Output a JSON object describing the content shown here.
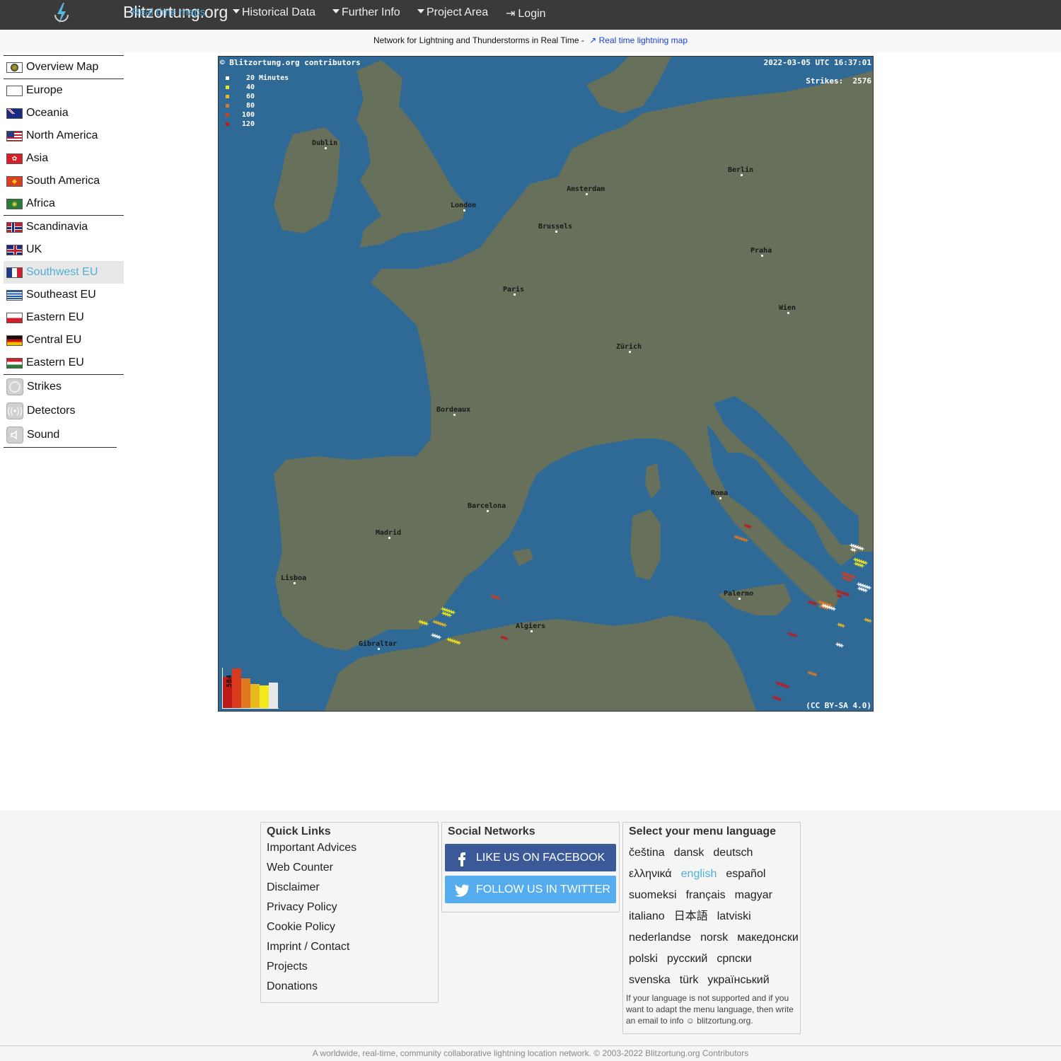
{
  "header": {
    "brand": "Blitzortung.org",
    "brand_overlay": "Real time maps",
    "nav": [
      {
        "label": "Historical Data"
      },
      {
        "label": "Further Info"
      },
      {
        "label": "Project Area"
      },
      {
        "label": "Login"
      }
    ]
  },
  "subbar": {
    "text": "Network for Lightning and Thunderstorms in Real Time -",
    "link": "Real time lightning map"
  },
  "sidebar": {
    "groups": [
      [
        {
          "label": "Overview Map",
          "icon": "globe-icon"
        }
      ],
      [
        {
          "label": "Europe",
          "icon": "flag-europe-icon"
        },
        {
          "label": "Oceania",
          "icon": "flag-australia-icon"
        },
        {
          "label": "North America",
          "icon": "flag-usa-icon"
        },
        {
          "label": "Asia",
          "icon": "flag-hongkong-icon"
        },
        {
          "label": "South America",
          "icon": "flag-south-america-icon"
        },
        {
          "label": "Africa",
          "icon": "flag-africa-icon"
        }
      ],
      [
        {
          "label": "Scandinavia",
          "icon": "flag-norway-icon"
        },
        {
          "label": "UK",
          "icon": "flag-uk-icon"
        },
        {
          "label": "Southwest EU",
          "icon": "flag-france-icon",
          "active": true
        },
        {
          "label": "Southeast EU",
          "icon": "flag-greece-icon"
        },
        {
          "label": "Eastern EU",
          "icon": "flag-poland-icon"
        },
        {
          "label": "Central EU",
          "icon": "flag-germany-icon"
        },
        {
          "label": "Eastern EU",
          "icon": "flag-hungary-icon"
        }
      ],
      [
        {
          "label": "Strikes",
          "icon": "strikes-icon"
        },
        {
          "label": "Detectors",
          "icon": "detectors-icon"
        },
        {
          "label": "Sound",
          "icon": "sound-icon"
        }
      ]
    ]
  },
  "map": {
    "attribution": "© Blitzortung.org contributors",
    "timestamp": "2022-03-05 UTC 16:37:01",
    "strikes_label": "Strikes:",
    "strikes_count": "2576",
    "license": "(CC BY-SA 4.0)",
    "legend": [
      {
        "value": "20",
        "unit": "Minutes",
        "color": "#ffffff"
      },
      {
        "value": "40",
        "unit": "",
        "color": "#f2e81e"
      },
      {
        "value": "60",
        "unit": "",
        "color": "#e8b91e"
      },
      {
        "value": "80",
        "unit": "",
        "color": "#e07820"
      },
      {
        "value": "100",
        "unit": "",
        "color": "#d83a1e"
      },
      {
        "value": "120",
        "unit": "",
        "color": "#c01818"
      }
    ],
    "histogram_label": "584",
    "cities": [
      "Dublin",
      "London",
      "Amsterdam",
      "Berlin",
      "Brussels",
      "Praha",
      "Paris",
      "Wien",
      "Zürich",
      "Bordeaux",
      "Roma",
      "Barcelona",
      "Madrid",
      "Lisboa",
      "Palermo",
      "Algiers",
      "Gibraltar"
    ],
    "colors": {
      "sea": "#2f6a96",
      "land": "#66705a",
      "border": "#e8e8e8"
    }
  },
  "footer": {
    "quick_links": {
      "title": "Quick Links",
      "items": [
        "Important Advices",
        "Web Counter",
        "Disclaimer",
        "Privacy Policy",
        "Cookie Policy",
        "Imprint / Contact",
        "Projects",
        "Donations"
      ]
    },
    "social": {
      "title": "Social Networks",
      "facebook": "LIKE US ON FACEBOOK",
      "twitter": "FOLLOW US IN TWITTER"
    },
    "language": {
      "title": "Select your menu language",
      "rows": [
        [
          "čeština",
          "dansk",
          "deutsch"
        ],
        [
          "ελληνικά",
          "english",
          "español"
        ],
        [
          "suomeksi",
          "français",
          "magyar"
        ],
        [
          "italiano",
          "日本語",
          "latviski"
        ],
        [
          "nederlandse",
          "norsk",
          "македонски"
        ],
        [
          "polski",
          "русский",
          "српски"
        ],
        [
          "svenska",
          "türk",
          "український"
        ]
      ],
      "current": "english",
      "note": "If your language is not supported and if you want to adapt the menu language, then write an email to info ☺ blitzortung.org."
    },
    "copyright": "A worldwide, real-time, community collaborative lightning location network. © 2003-2022 Blitzortung.org Contributors"
  }
}
